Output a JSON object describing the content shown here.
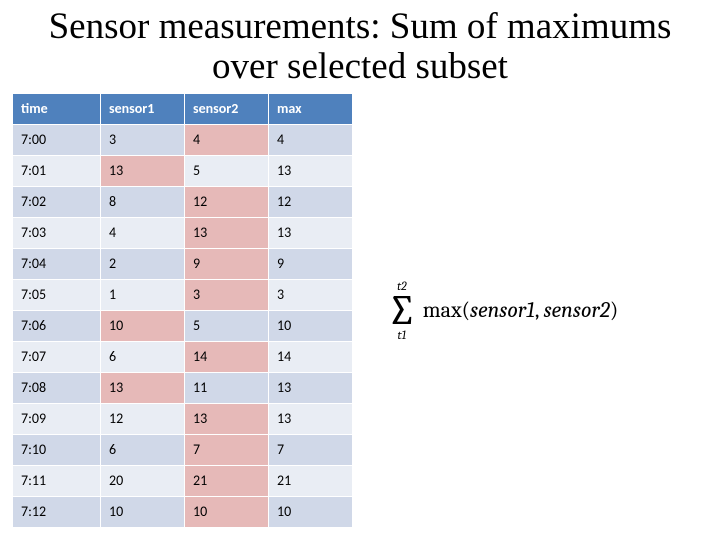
{
  "title": "Sensor measurements: Sum of maximums over selected subset",
  "headers": {
    "time": "time",
    "s1": "sensor1",
    "s2": "sensor2",
    "max": "max"
  },
  "rows": [
    {
      "time": "7:00",
      "s1": "3",
      "s2": "4",
      "max": "4",
      "hl": "s2"
    },
    {
      "time": "7:01",
      "s1": "13",
      "s2": "5",
      "max": "13",
      "hl": "s1"
    },
    {
      "time": "7:02",
      "s1": "8",
      "s2": "12",
      "max": "12",
      "hl": "s2"
    },
    {
      "time": "7:03",
      "s1": "4",
      "s2": "13",
      "max": "13",
      "hl": "s2"
    },
    {
      "time": "7:04",
      "s1": "2",
      "s2": "9",
      "max": "9",
      "hl": "s2"
    },
    {
      "time": "7:05",
      "s1": "1",
      "s2": "3",
      "max": "3",
      "hl": "s2"
    },
    {
      "time": "7:06",
      "s1": "10",
      "s2": "5",
      "max": "10",
      "hl": "s1"
    },
    {
      "time": "7:07",
      "s1": "6",
      "s2": "14",
      "max": "14",
      "hl": "s2"
    },
    {
      "time": "7:08",
      "s1": "13",
      "s2": "11",
      "max": "13",
      "hl": "s1"
    },
    {
      "time": "7:09",
      "s1": "12",
      "s2": "13",
      "max": "13",
      "hl": "s2"
    },
    {
      "time": "7:10",
      "s1": "6",
      "s2": "7",
      "max": "7",
      "hl": "s2"
    },
    {
      "time": "7:11",
      "s1": "20",
      "s2": "21",
      "max": "21",
      "hl": "s2"
    },
    {
      "time": "7:12",
      "s1": "10",
      "s2": "10",
      "max": "10",
      "hl": "s2"
    }
  ],
  "formula": {
    "upper": "t2",
    "lower": "t1",
    "fn": "max",
    "arg1": "sensor1",
    "sep": ", ",
    "arg2": "sensor2"
  },
  "chart_data": {
    "type": "table",
    "title": "Sensor measurements: Sum of maximums over selected subset",
    "columns": [
      "time",
      "sensor1",
      "sensor2",
      "max"
    ],
    "rows": [
      [
        "7:00",
        3,
        4,
        4
      ],
      [
        "7:01",
        13,
        5,
        13
      ],
      [
        "7:02",
        8,
        12,
        12
      ],
      [
        "7:03",
        4,
        13,
        13
      ],
      [
        "7:04",
        2,
        9,
        9
      ],
      [
        "7:05",
        1,
        3,
        3
      ],
      [
        "7:06",
        10,
        5,
        10
      ],
      [
        "7:07",
        6,
        14,
        14
      ],
      [
        "7:08",
        13,
        11,
        13
      ],
      [
        "7:09",
        12,
        13,
        13
      ],
      [
        "7:10",
        6,
        7,
        7
      ],
      [
        "7:11",
        20,
        21,
        21
      ],
      [
        "7:12",
        10,
        10,
        10
      ]
    ]
  }
}
